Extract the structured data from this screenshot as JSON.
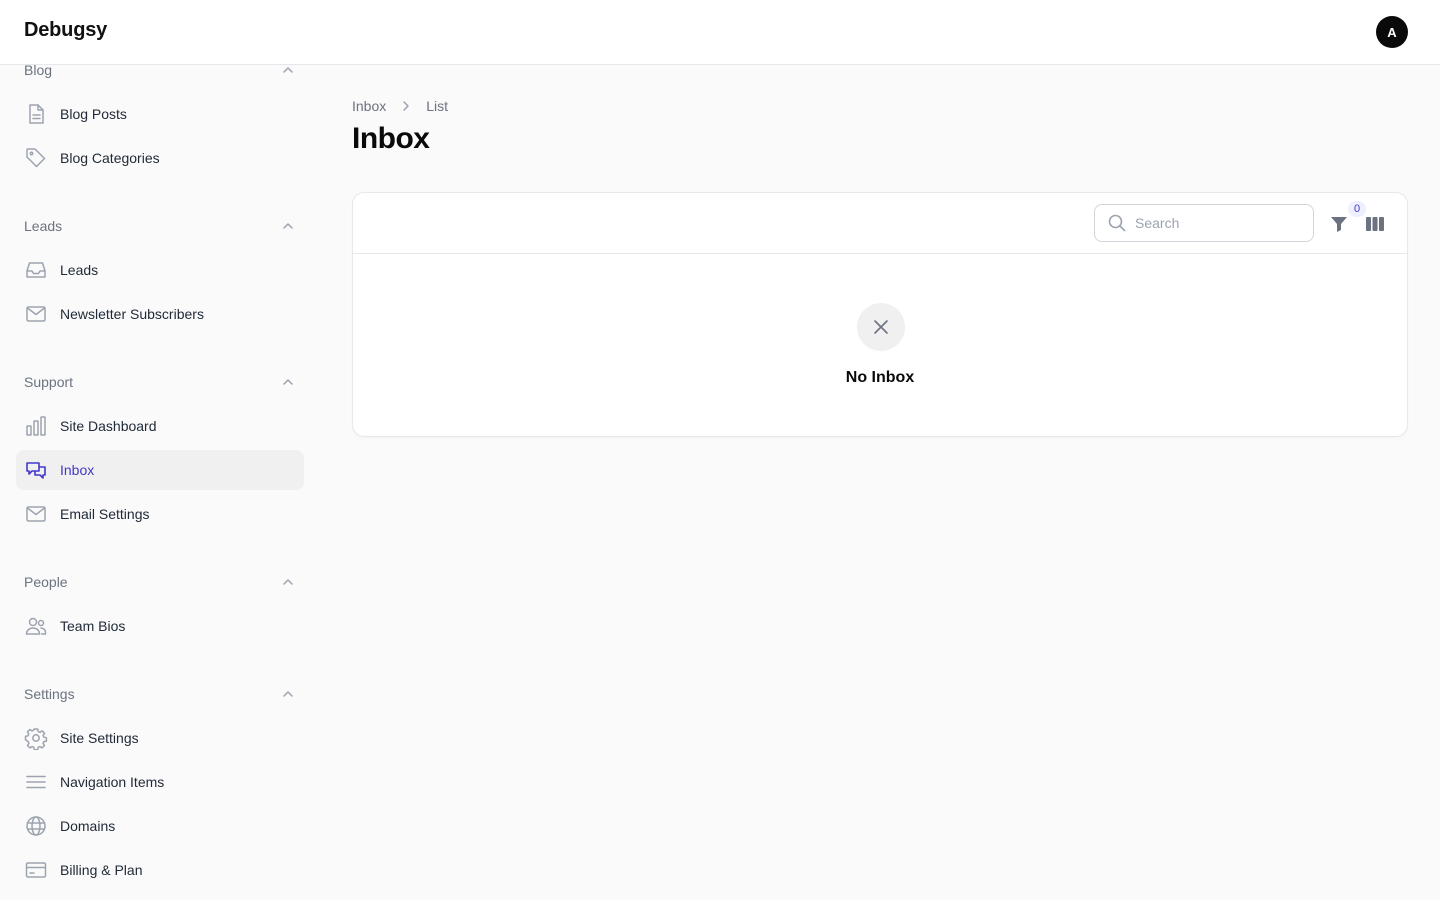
{
  "app": {
    "brand": "Debugsy",
    "avatar_initial": "A"
  },
  "sidebar": {
    "groups": [
      {
        "label": "Blog",
        "items": [
          {
            "label": "Blog Posts",
            "icon": "document-icon"
          },
          {
            "label": "Blog Categories",
            "icon": "tag-icon"
          }
        ]
      },
      {
        "label": "Leads",
        "items": [
          {
            "label": "Leads",
            "icon": "inbox-tray-icon"
          },
          {
            "label": "Newsletter Subscribers",
            "icon": "envelope-icon"
          }
        ]
      },
      {
        "label": "Support",
        "items": [
          {
            "label": "Site Dashboard",
            "icon": "bar-chart-icon"
          },
          {
            "label": "Inbox",
            "icon": "chat-bubbles-icon",
            "active": true
          },
          {
            "label": "Email Settings",
            "icon": "envelope-icon"
          }
        ]
      },
      {
        "label": "People",
        "items": [
          {
            "label": "Team Bios",
            "icon": "users-icon"
          }
        ]
      },
      {
        "label": "Settings",
        "items": [
          {
            "label": "Site Settings",
            "icon": "gear-icon"
          },
          {
            "label": "Navigation Items",
            "icon": "menu-lines-icon"
          },
          {
            "label": "Domains",
            "icon": "globe-icon"
          },
          {
            "label": "Billing & Plan",
            "icon": "credit-card-icon"
          }
        ]
      }
    ]
  },
  "breadcrumb": {
    "items": [
      "Inbox",
      "List"
    ]
  },
  "page": {
    "title": "Inbox"
  },
  "table": {
    "search_placeholder": "Search",
    "filter_count": "0",
    "empty_heading": "No Inbox"
  },
  "colors": {
    "accent": "#4338ca",
    "active_bg": "#f0f0f0",
    "page_bg": "#fafafa"
  }
}
